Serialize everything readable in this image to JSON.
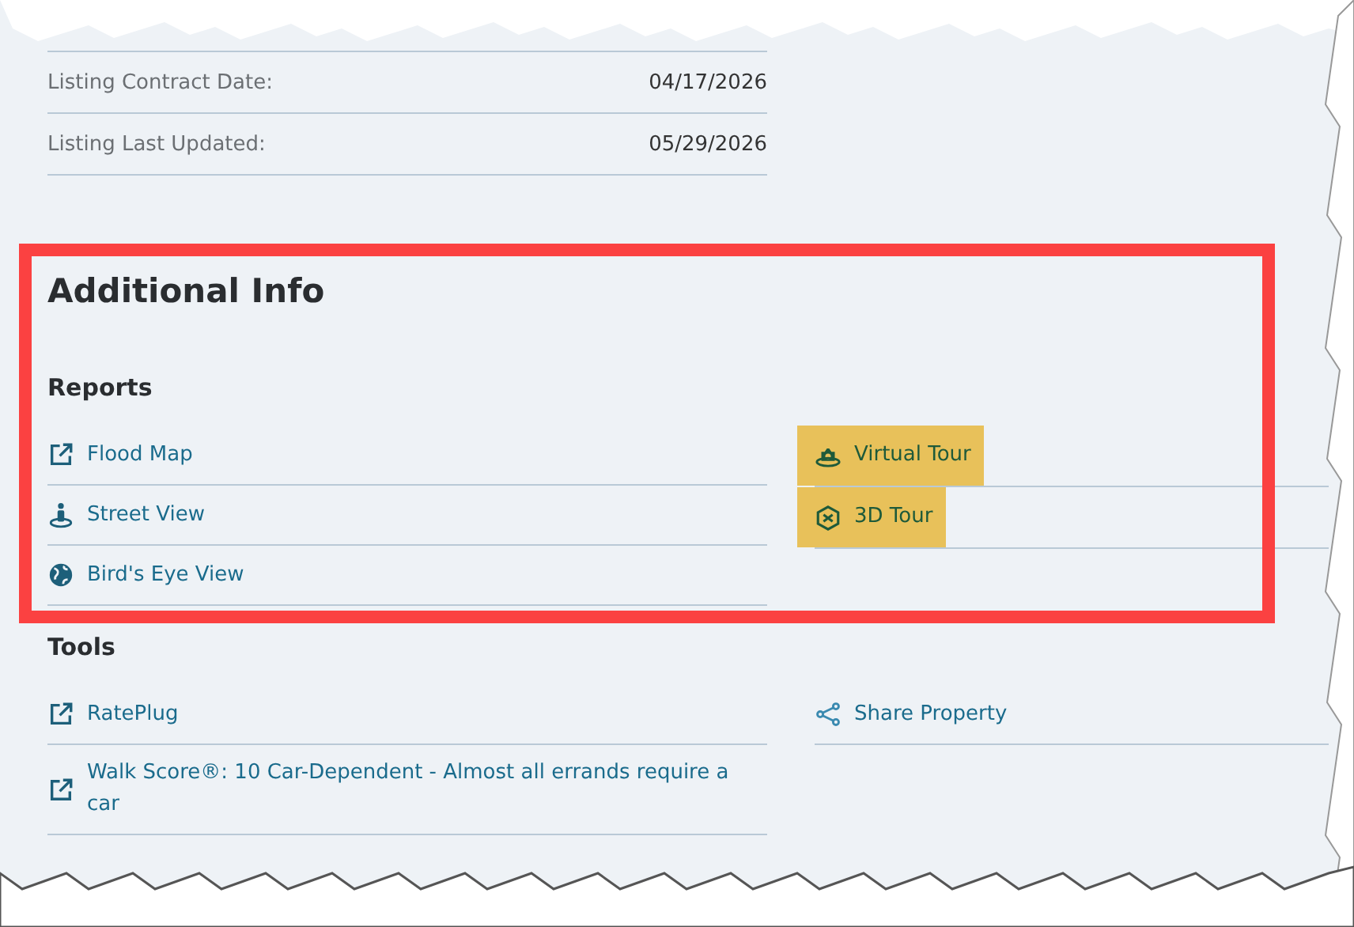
{
  "listing_details": [
    {
      "label": "Listing Contract Date:",
      "value": "04/17/2026"
    },
    {
      "label": "Listing Last Updated:",
      "value": "05/29/2026"
    }
  ],
  "additional_info": {
    "title": "Additional Info",
    "framed": true,
    "reports": {
      "heading": "Reports",
      "left": [
        {
          "label": "Flood Map",
          "kind": "external",
          "highlighted": false
        },
        {
          "label": "Street View",
          "kind": "person",
          "highlighted": false
        },
        {
          "label": "Bird's Eye View",
          "kind": "globe",
          "highlighted": false
        }
      ],
      "right": [
        {
          "label": "Virtual Tour",
          "kind": "camera360",
          "highlighted": true
        },
        {
          "label": "3D Tour",
          "kind": "cube",
          "highlighted": true
        }
      ]
    }
  },
  "tools": {
    "heading": "Tools",
    "left": [
      {
        "label": "RatePlug",
        "kind": "external"
      },
      {
        "label": "Walk Score®: 10 Car-Dependent - Almost all errands require a car",
        "kind": "external"
      }
    ],
    "right": [
      {
        "label": "Share Property",
        "kind": "share"
      }
    ]
  }
}
